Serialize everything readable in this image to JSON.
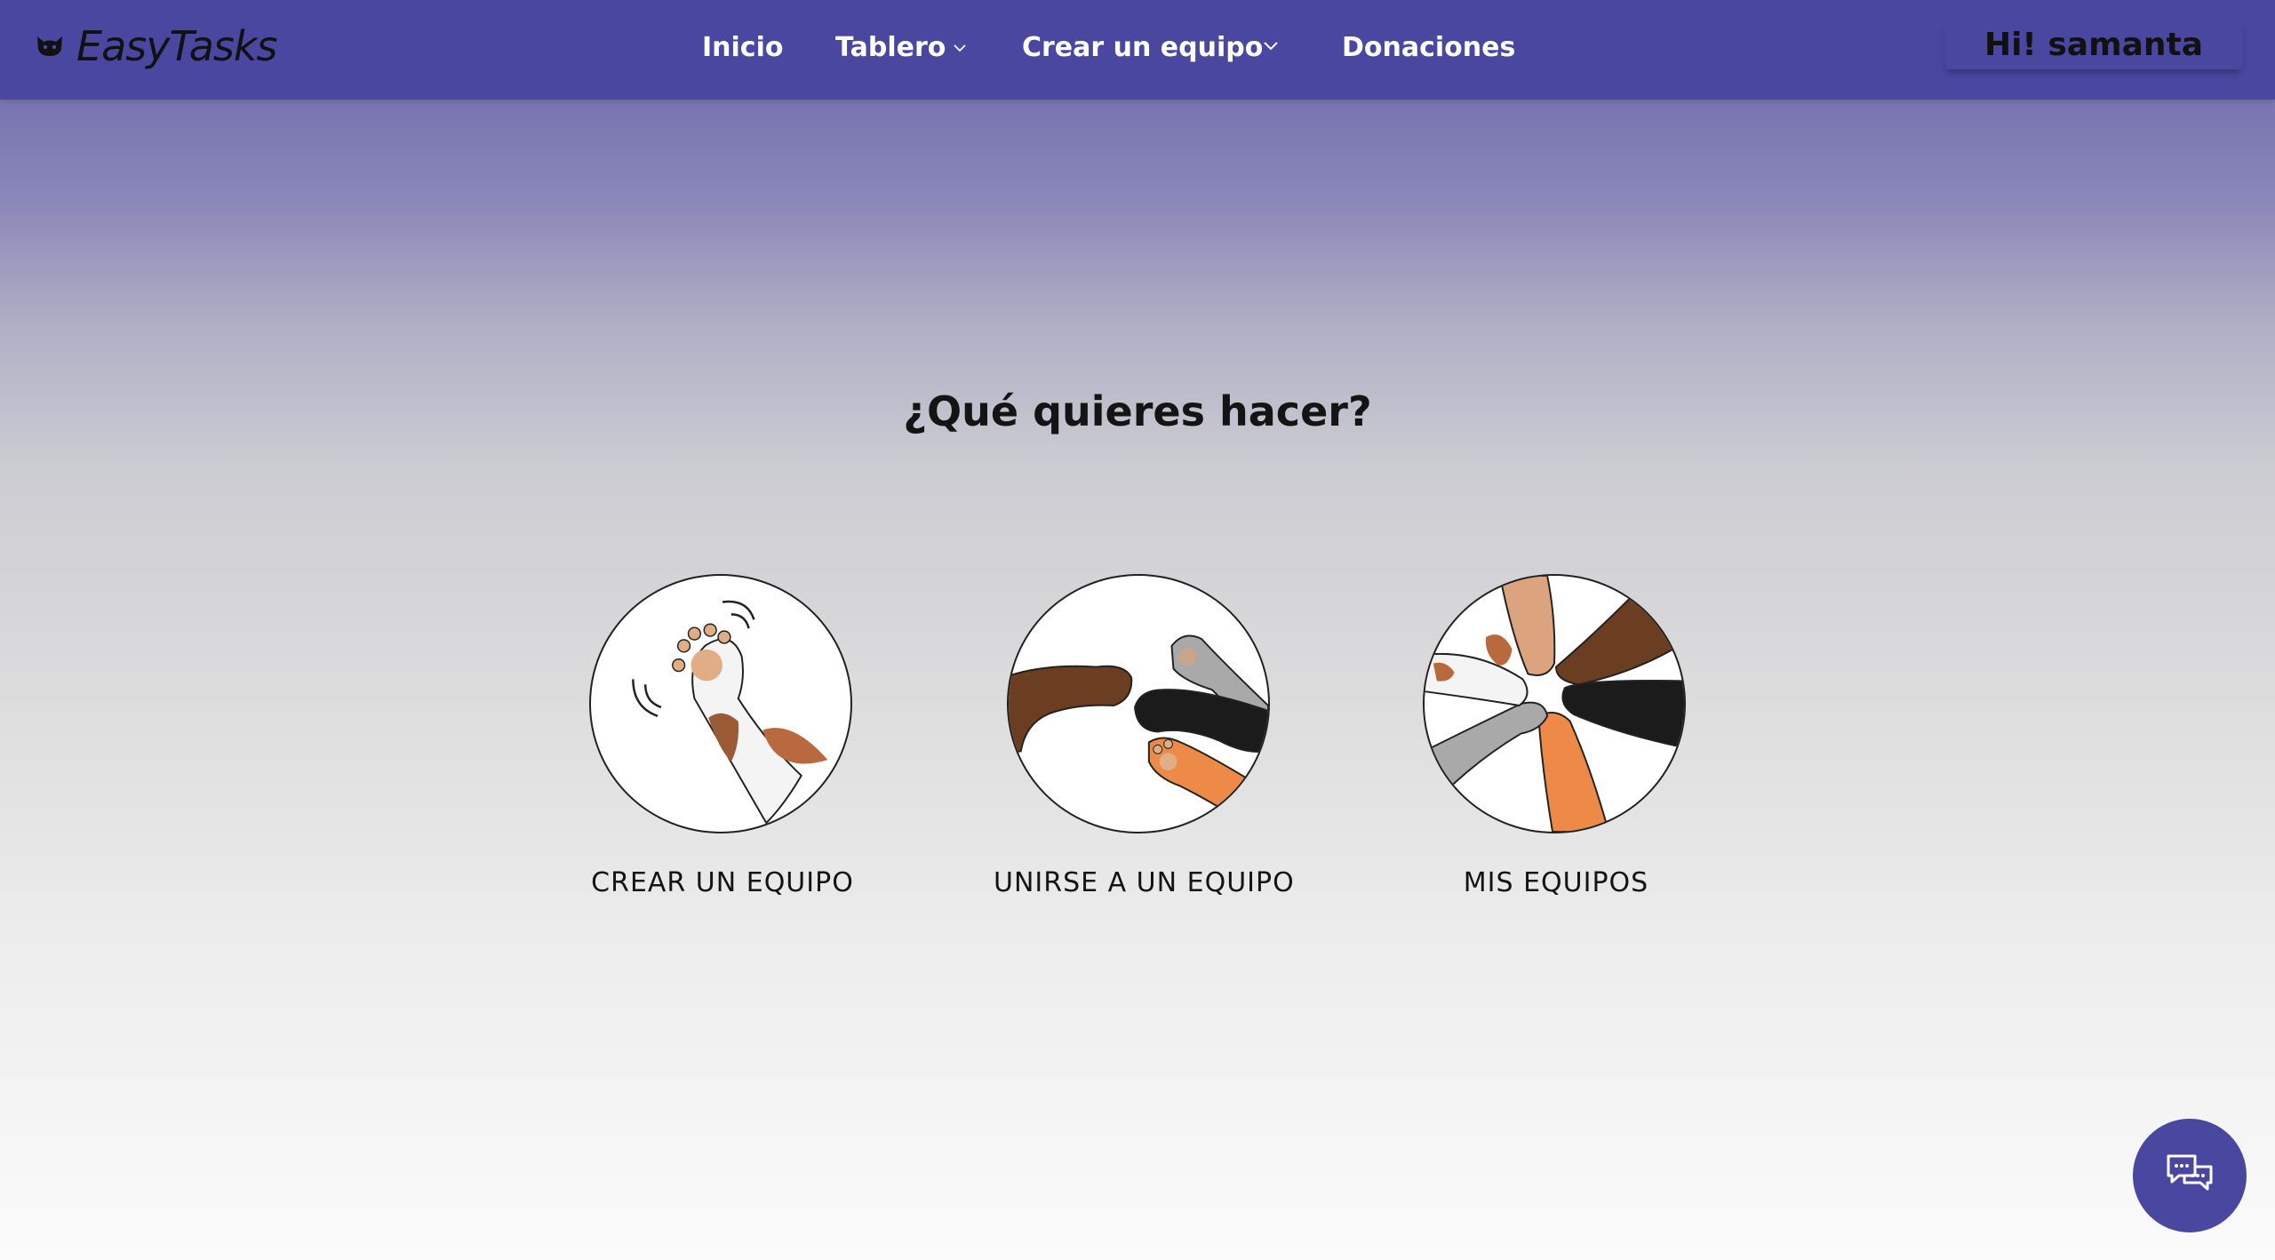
{
  "navbar": {
    "brand": "EasyTasks",
    "brand_icon": "cat-icon",
    "items": [
      {
        "label": "Inicio",
        "has_dropdown": false
      },
      {
        "label": "Tablero",
        "has_dropdown": true
      },
      {
        "label": "Crear un equipo",
        "has_dropdown": true
      },
      {
        "label": "Donaciones",
        "has_dropdown": false
      }
    ],
    "user_greeting": "Hi! samanta",
    "background_color": "#4a47a0"
  },
  "main": {
    "heading": "¿Qué quieres hacer?",
    "options": [
      {
        "label": "CREAR UN EQUIPO",
        "icon": "waving-paw-icon"
      },
      {
        "label": "UNIRSE A UN EQUIPO",
        "icon": "paws-joining-icon"
      },
      {
        "label": "MIS EQUIPOS",
        "icon": "paws-circle-icon"
      }
    ]
  },
  "chat_button": {
    "icon": "chat-bubbles-icon",
    "color": "#4a47a0"
  }
}
